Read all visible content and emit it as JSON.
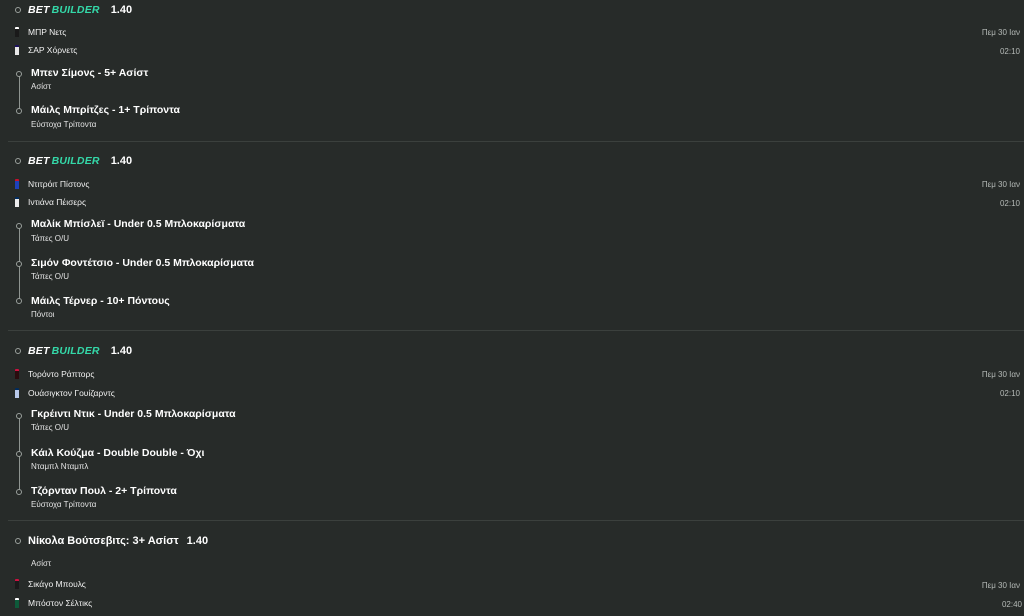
{
  "colors": {
    "background": "#272b29",
    "builder_accent": "#34d9a9",
    "divider": "#3b403d",
    "muted_text": "#b5bab7"
  },
  "bets": [
    {
      "logo_bet": "BET",
      "logo_builder": "BUILDER",
      "odds": "1.40",
      "home_team": {
        "name": "ΜΠΡ Νετς",
        "jersey_color": "#1a1a1a",
        "jersey_accent": "#ffffff"
      },
      "away_team": {
        "name": "ΣΑΡ Χόρνετς",
        "jersey_color": "#e8e8e8",
        "jersey_accent": "#1d1160"
      },
      "date": "Πεμ 30 Ιαν",
      "time": "02:10",
      "legs": [
        {
          "title": "Μπεν Σίμονς - 5+ Ασίστ",
          "market": "Ασίστ"
        },
        {
          "title": "Μάιλς Μπρίτζες - 1+ Τρίποντα",
          "market": "Εύστοχα Τρίποντα"
        }
      ]
    },
    {
      "logo_bet": "BET",
      "logo_builder": "BUILDER",
      "odds": "1.40",
      "home_team": {
        "name": "Ντιτρόιτ Πίστονς",
        "jersey_color": "#1d42ba",
        "jersey_accent": "#c8102e"
      },
      "away_team": {
        "name": "Ιντιάνα Πέισερς",
        "jersey_color": "#ececec",
        "jersey_accent": "#002d62"
      },
      "date": "Πεμ 30 Ιαν",
      "time": "02:10",
      "legs": [
        {
          "title": "Μαλίκ Μπίσλεϊ - Under 0.5 Μπλοκαρίσματα",
          "market": "Τάπες O/U"
        },
        {
          "title": "Σιμόν Φοντέτσιο - Under 0.5 Μπλοκαρίσματα",
          "market": "Τάπες O/U"
        },
        {
          "title": "Μάιλς Τέρνερ - 10+ Πόντους",
          "market": "Πόντοι"
        }
      ]
    },
    {
      "logo_bet": "BET",
      "logo_builder": "BUILDER",
      "odds": "1.40",
      "home_team": {
        "name": "Τορόντο Ράπτορς",
        "jersey_color": "#2a0c0e",
        "jersey_accent": "#ce1141"
      },
      "away_team": {
        "name": "Ουάσιγκτον Γουίζαρντς",
        "jersey_color": "#b9c9ea",
        "jersey_accent": "#002b5c"
      },
      "date": "Πεμ 30 Ιαν",
      "time": "02:10",
      "legs": [
        {
          "title": "Γκρέιντι Ντικ - Under 0.5 Μπλοκαρίσματα",
          "market": "Τάπες O/U"
        },
        {
          "title": "Κάιλ Κούζμα - Double Double - Όχι",
          "market": "Νταμπλ Νταμπλ"
        },
        {
          "title": "Τζόρνταν Πουλ - 2+ Τρίποντα",
          "market": "Εύστοχα Τρίποντα"
        }
      ]
    }
  ],
  "single": {
    "title": "Νίκολα Βούτσεβιτς: 3+ Ασίστ",
    "odds": "1.40",
    "market": "Ασίστ",
    "home_team": {
      "name": "Σικάγο Μπουλς",
      "jersey_color": "#1a1a1a",
      "jersey_accent": "#ce1141"
    },
    "away_team": {
      "name": "Μπόστον Σέλτικς",
      "jersey_color": "#0e5a3a",
      "jersey_accent": "#ffffff"
    },
    "date": "Πεμ 30 Ιαν",
    "time": "02:40"
  }
}
